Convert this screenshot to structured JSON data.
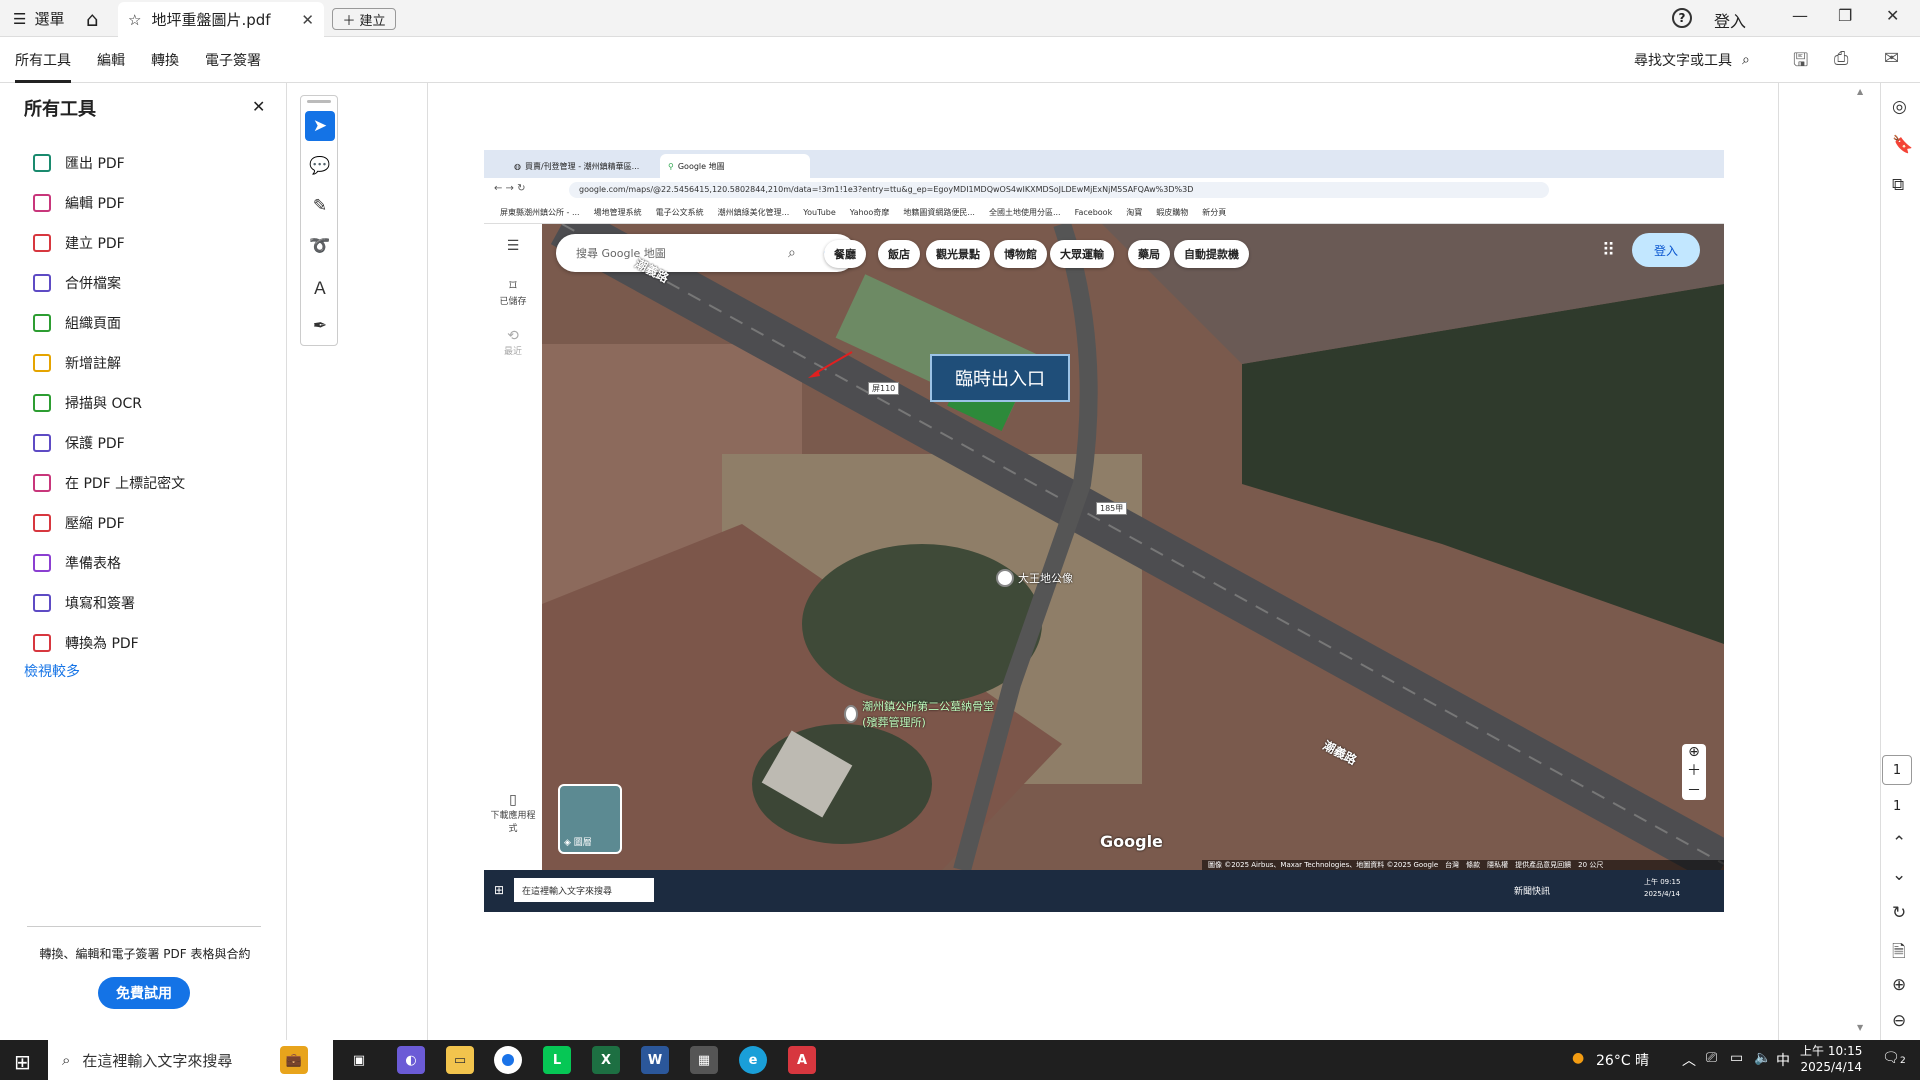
{
  "titlebar": {
    "menu_label": "選單",
    "tab_title": "地坪重盤圖片.pdf",
    "new_tab_label": "建立",
    "login_label": "登入"
  },
  "toolbar": {
    "tabs": [
      "所有工具",
      "編輯",
      "轉換",
      "電子簽署"
    ],
    "find_label": "尋找文字或工具"
  },
  "left_panel": {
    "title": "所有工具",
    "items": [
      {
        "label": "匯出 PDF",
        "color": "#1a8a6e"
      },
      {
        "label": "編輯 PDF",
        "color": "#c8367b"
      },
      {
        "label": "建立 PDF",
        "color": "#d7373f"
      },
      {
        "label": "合併檔案",
        "color": "#5e4bc4"
      },
      {
        "label": "組織頁面",
        "color": "#2d9d32"
      },
      {
        "label": "新增註解",
        "color": "#e5a400"
      },
      {
        "label": "掃描與 OCR",
        "color": "#2d9d32"
      },
      {
        "label": "保護 PDF",
        "color": "#5e4bc4"
      },
      {
        "label": "在 PDF 上標記密文",
        "color": "#c8367b"
      },
      {
        "label": "壓縮 PDF",
        "color": "#d7373f"
      },
      {
        "label": "準備表格",
        "color": "#8b3fd1"
      },
      {
        "label": "填寫和簽署",
        "color": "#5e4bc4"
      },
      {
        "label": "轉換為 PDF",
        "color": "#d7373f"
      }
    ],
    "more_label": "檢視較多",
    "promo_text": "轉換、編輯和電子簽署 PDF 表格與合約",
    "trial_label": "免費試用"
  },
  "document": {
    "chrome_tabs": [
      "買賣/刊登管理 - 潮州鎮精華區...",
      "Google 地圖"
    ],
    "url": "google.com/maps/@22.5456415,120.5802844,210m/data=!3m1!1e3?entry=ttu&g_ep=EgoyMDI1MDQwOS4wIKXMDSoJLDEwMjExNjM5SAFQAw%3D%3D",
    "bookmarks": [
      "屏東縣潮州鎮公所 - ...",
      "場地管理系統",
      "電子公文系統",
      "潮州鎮綠美化管理...",
      "YouTube",
      "Yahoo奇摩",
      "地籍圖資網路便民...",
      "全國土地使用分區...",
      "Facebook",
      "淘寶",
      "蝦皮購物",
      "新分頁"
    ],
    "map_search_placeholder": "搜尋 Google 地圖",
    "map_chips": [
      "餐廳",
      "飯店",
      "觀光景點",
      "博物館",
      "大眾運輸",
      "藥局",
      "自動提款機"
    ],
    "map_login": "登入",
    "side_saved": "已儲存",
    "side_recent": "最近",
    "side_download": "下載應用程式",
    "callout": "臨時出入口",
    "road_label_top": "潮義路",
    "road_label_bottom": "潮義路",
    "route_110": "屏110",
    "route_185": "185甲",
    "poi_1": "大王地公像",
    "poi_2": "潮州鎮公所第二公墓納骨堂(殯葬管理所)",
    "layers_label": "圖層",
    "google_logo": "Google",
    "attribution": "圖像 ©2025 Airbus、Maxar Technologies、地圖資料 ©2025 Google　台灣　條款　隱私權　提供產品意見回饋　20 公尺",
    "mini_search": "在這裡輸入文字來搜尋",
    "mini_clock": "上午 09:15 2025/4/14",
    "mini_news": "新聞快訊"
  },
  "page_nav": {
    "current": "1",
    "total": "1"
  },
  "taskbar": {
    "search_placeholder": "在這裡輸入文字來搜尋",
    "weather": "26°C 晴",
    "ime": "中",
    "time": "上午 10:15",
    "date": "2025/4/14",
    "notifications": "2"
  },
  "colors": {
    "accent": "#1473e6",
    "callout_bg": "#1f4e79"
  }
}
